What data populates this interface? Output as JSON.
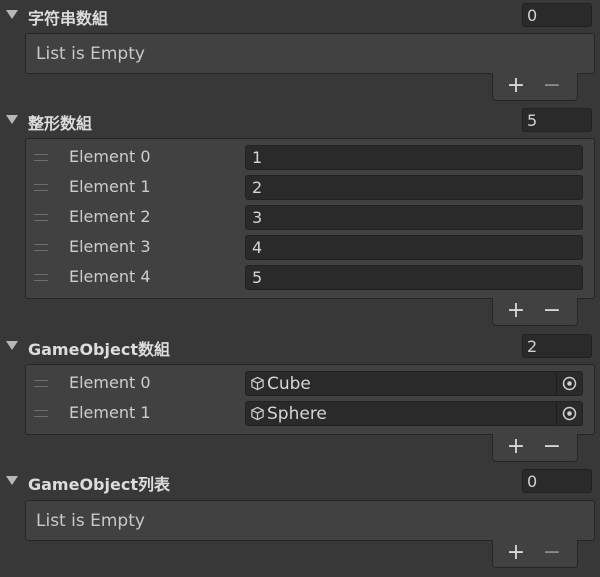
{
  "sections": [
    {
      "title": "字符串数組",
      "size": "0",
      "empty_text": "List is Empty"
    },
    {
      "title": "整形数組",
      "size": "5",
      "elements": [
        {
          "label": "Element 0",
          "value": "1"
        },
        {
          "label": "Element 1",
          "value": "2"
        },
        {
          "label": "Element 2",
          "value": "3"
        },
        {
          "label": "Element 3",
          "value": "4"
        },
        {
          "label": "Element 4",
          "value": "5"
        }
      ]
    },
    {
      "title": "GameObject数組",
      "size": "2",
      "elements": [
        {
          "label": "Element 0",
          "value": "Cube",
          "icon": "cube-icon"
        },
        {
          "label": "Element 1",
          "value": "Sphere",
          "icon": "cube-icon"
        }
      ]
    },
    {
      "title": "GameObject列表",
      "size": "0",
      "empty_text": "List is Empty"
    }
  ],
  "buttons": {
    "add": "+",
    "remove": "−"
  },
  "icons": {
    "foldout": "triangle-down-icon",
    "handle": "drag-handle-icon",
    "picker": "object-picker-icon"
  }
}
